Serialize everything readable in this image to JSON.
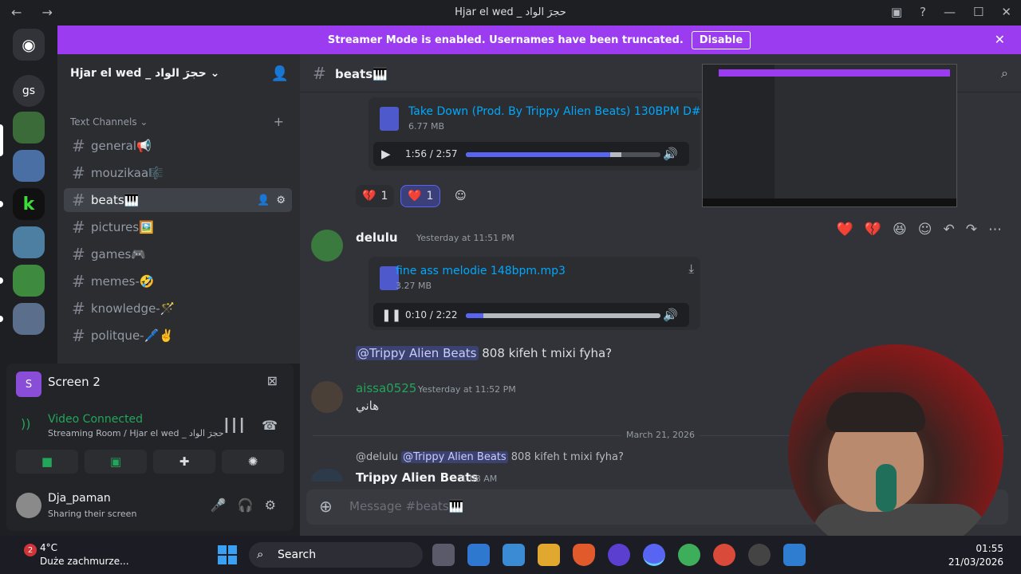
{
  "window": {
    "title": "Hjar el wed _ حجرَ الواد",
    "nav_arrows": "← →"
  },
  "banner": {
    "text": "Streamer Mode is enabled. Usernames have been truncated.",
    "button": "Disable"
  },
  "rail": {
    "home_label": "gs"
  },
  "sidebar": {
    "server_name": "Hjar el wed _ حجرَ الواد",
    "category": "Text Channels",
    "channels": [
      {
        "name": "general📢"
      },
      {
        "name": "mouzikaa🎼"
      },
      {
        "name": "beats🎹"
      },
      {
        "name": "pictures🖼️"
      },
      {
        "name": "games🎮"
      },
      {
        "name": "memes-🤣"
      },
      {
        "name": "knowledge-🪄"
      },
      {
        "name": "politque-🖊️✌️"
      }
    ]
  },
  "voice": {
    "screen_badge": "S",
    "screen_title": "Screen 2",
    "status": "Video Connected",
    "room": "Streaming Room / Hjar el wed _ حجرَ الواد",
    "user_name": "Dja_paman",
    "user_status": "Sharing their screen"
  },
  "chat": {
    "channel": "beats🎹",
    "file1": {
      "name": "Take Down (Prod. By Trippy Alien Beats) 130BPM D# m",
      "size": "6.77 MB",
      "time": "1:56 / 2:57",
      "progress": 0.74,
      "buffered": 0.8
    },
    "reaction1_count": "1",
    "reaction2_count": "1",
    "msg1": {
      "author": "delulu",
      "timestamp": "Yesterday at 11:51 PM"
    },
    "file2": {
      "name": "fine ass melodie 148bpm.mp3",
      "size": "3.27 MB",
      "time": "0:10 / 2:22",
      "progress": 0.09,
      "buffered": 1.0
    },
    "msg1_text": {
      "mention": "@Trippy Alien Beats",
      "text": " 808 kifeh t mixi fyha?"
    },
    "msg2": {
      "author": "aissa0525",
      "timestamp": "Yesterday at 11:52 PM",
      "text": "هاني"
    },
    "date_divider": "March 21, 2026",
    "reply": {
      "author": "@delulu",
      "mention": "@Trippy Alien Beats",
      "text": " 808 kifeh t mixi fyha?"
    },
    "msg3": {
      "author": "Trippy Alien Beats",
      "timestamp": "1:08 AM"
    },
    "composer_placeholder": "Message #beats🎹"
  },
  "taskbar": {
    "temperature": "4°C",
    "weather": "Duże zachmurze...",
    "badge": "2",
    "search": "Search",
    "time": "01:55",
    "date": "21/03/2026"
  },
  "colors": {
    "accent": "#5865f2",
    "banner": "#9b3cf0",
    "online": "#23a55a",
    "link": "#00a8fc"
  }
}
